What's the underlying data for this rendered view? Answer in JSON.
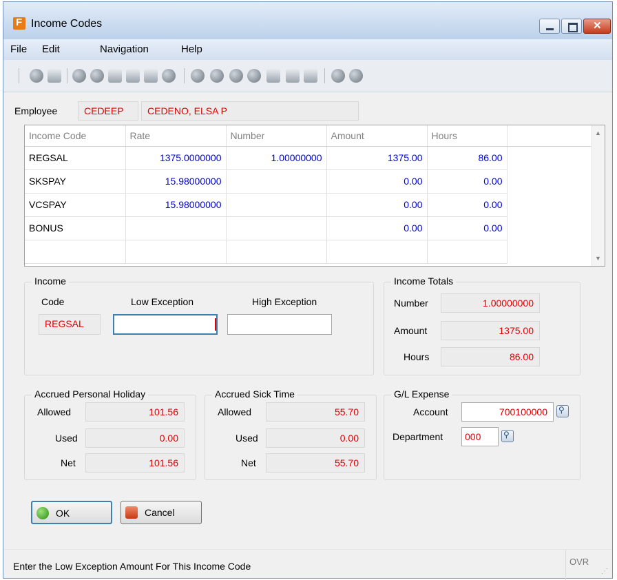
{
  "window": {
    "title": "Income Codes"
  },
  "menu": [
    "File",
    "Edit",
    "Navigation",
    "Help"
  ],
  "toolbar_icons": [
    "power-icon",
    "copy-icon",
    "check-icon",
    "cancel-icon",
    "doc-icon",
    "doc-copy-icon",
    "doc-select-icon",
    "zoom-icon",
    "download-icon",
    "filter-icon",
    "down-icon",
    "up-icon",
    "import-icon",
    "export-icon",
    "delete-icon",
    "chart-icon",
    "help-icon"
  ],
  "employee": {
    "label": "Employee",
    "code": "CEDEEP",
    "name": "CEDENO, ELSA P"
  },
  "grid": {
    "columns": [
      "Income Code",
      "Rate",
      "Number",
      "Amount",
      "Hours"
    ],
    "rows": [
      [
        "REGSAL",
        "1375.0000000",
        "1.00000000",
        "1375.00",
        "86.00"
      ],
      [
        "SKSPAY",
        "15.98000000",
        "",
        "0.00",
        "0.00"
      ],
      [
        "VCSPAY",
        "15.98000000",
        "",
        "0.00",
        "0.00"
      ],
      [
        "BONUS",
        "",
        "",
        "0.00",
        "0.00"
      ]
    ]
  },
  "income": {
    "title": "Income",
    "code_label": "Code",
    "low_label": "Low Exception",
    "high_label": "High Exception",
    "code_value": "REGSAL",
    "low_value": "",
    "high_value": ""
  },
  "income_totals": {
    "title": "Income Totals",
    "number_label": "Number",
    "number": "1.00000000",
    "amount_label": "Amount",
    "amount": "1375.00",
    "hours_label": "Hours",
    "hours": "86.00"
  },
  "personal_holiday": {
    "title": "Accrued Personal Holiday",
    "allowed_label": "Allowed",
    "allowed": "101.56",
    "used_label": "Used",
    "used": "0.00",
    "net_label": "Net",
    "net": "101.56"
  },
  "sick_time": {
    "title": "Accrued Sick Time",
    "allowed_label": "Allowed",
    "allowed": "55.70",
    "used_label": "Used",
    "used": "0.00",
    "net_label": "Net",
    "net": "55.70"
  },
  "gl_expense": {
    "title": "G/L Expense",
    "account_label": "Account",
    "account": "700100000",
    "department_label": "Department",
    "department": "000"
  },
  "buttons": {
    "ok": "OK",
    "cancel": "Cancel"
  },
  "status": {
    "message": "Enter the Low Exception Amount For This Income Code",
    "mode": "OVR"
  },
  "colors": {
    "value_red": "#e00000",
    "grid_blue": "#0000e0",
    "title_gradient": "#bcd1ea"
  }
}
